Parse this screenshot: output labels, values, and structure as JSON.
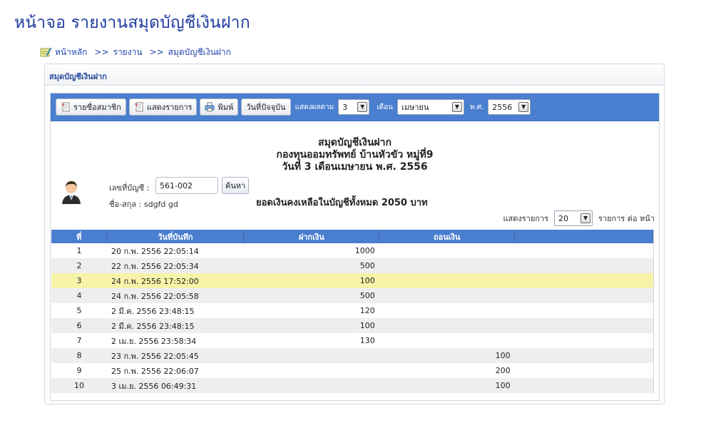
{
  "page": {
    "title": "หน้าจอ รายงานสมุดบัญชีเงินฝาก"
  },
  "breadcrumb": {
    "home": "หน้าหลัก",
    "sep1": ">>",
    "item1": "รายงาน",
    "sep2": ">>",
    "item2": "สมุดบัญชีเงินฝาก"
  },
  "panel": {
    "title": "สมุดบัญชีเงินฝาก"
  },
  "toolbar": {
    "members_label": "รายชื่อสมาชิก",
    "list_label": "แสดงรายการ",
    "print_label": "พิมพ์",
    "today_label": "วันที่ปัจจุบัน",
    "show_by_label": "แสดงผลตาม",
    "show_by_value": "3",
    "month_label": "เดือน",
    "month_value": "เมษายน",
    "year_label": "พ.ศ.",
    "year_value": "2556"
  },
  "report": {
    "line1": "สมุดบัญชีเงินฝาก",
    "line2": "กองทุนออมทรัพทย์ บ้านหัวขัว หมู่ที่9",
    "line3": "วันที่ 3 เดือนเมษายน พ.ศ. 2556",
    "account_label": "เลขที่บัญชี :",
    "account_value": "561-002",
    "search_label": "ค้นหา",
    "name_label": "ชื่อ-สกุล : sdgfd gd",
    "balance_text": "ยอดเงินคงเหลือในบัญชีทั้งหมด  2050 บาท",
    "perpage_label": "แสดงรายการ",
    "perpage_value": "20",
    "perpage_suffix": "รายการ ต่อ หน้า"
  },
  "table": {
    "headers": [
      "ที่",
      "วันที่บันทึก",
      "ฝากเงิน",
      "ถอนเงิน",
      ""
    ],
    "rows": [
      {
        "no": "1",
        "date": "20 ก.พ. 2556 22:05:14",
        "deposit": "1000",
        "withdraw": ""
      },
      {
        "no": "2",
        "date": "22 ก.พ. 2556 22:05:34",
        "deposit": "500",
        "withdraw": ""
      },
      {
        "no": "3",
        "date": "24 ก.พ. 2556 17:52:00",
        "deposit": "100",
        "withdraw": ""
      },
      {
        "no": "4",
        "date": "24 ก.พ. 2556 22:05:58",
        "deposit": "500",
        "withdraw": ""
      },
      {
        "no": "5",
        "date": "2 มี.ค. 2556 23:48:15",
        "deposit": "120",
        "withdraw": ""
      },
      {
        "no": "6",
        "date": "2 มี.ค. 2556 23:48:15",
        "deposit": "100",
        "withdraw": ""
      },
      {
        "no": "7",
        "date": "2 เม.ย. 2556 23:58:34",
        "deposit": "130",
        "withdraw": ""
      },
      {
        "no": "8",
        "date": "23 ก.พ. 2556 22:05:45",
        "deposit": "",
        "withdraw": "100"
      },
      {
        "no": "9",
        "date": "25 ก.พ. 2556 22:06:07",
        "deposit": "",
        "withdraw": "200"
      },
      {
        "no": "10",
        "date": "3 เม.ย. 2556 06:49:31",
        "deposit": "",
        "withdraw": "100"
      }
    ]
  },
  "colors": {
    "accent": "#4a7fd0",
    "title": "#1f3b9f",
    "highlight": "#f7f3a8"
  }
}
